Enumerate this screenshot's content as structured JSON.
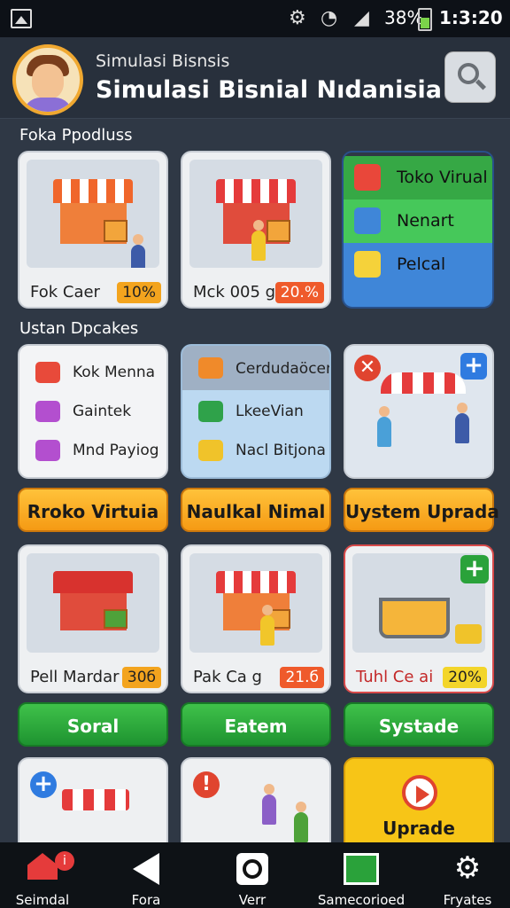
{
  "status": {
    "battery": "38%",
    "time": "1:3:20"
  },
  "header": {
    "subtitle": "Simulasi Bisnsis",
    "title": "Simulasi Bisnial Nıdanisia"
  },
  "section1": {
    "label": "Foka Ppodluss"
  },
  "row1": {
    "card1": {
      "label": "Fok Caer",
      "pct": "10%"
    },
    "card2": {
      "label": "Mck 005 g",
      "pct": "20.%"
    },
    "menu": [
      {
        "label": "Toko Virual",
        "color": "#36a845"
      },
      {
        "label": "Nenart",
        "color": "#46c85a"
      },
      {
        "label": "Pelcal",
        "color": "#3f86d8"
      }
    ]
  },
  "section2": {
    "label": "Ustan Dpcakes"
  },
  "row2": {
    "list1": [
      "Kok Menna",
      "Gaintek",
      "Mnd Payiog"
    ],
    "list2": [
      "Cerdudaöcen",
      "LkeeVian",
      "Nacl Bitjona"
    ]
  },
  "buttons1": [
    "Rroko Virtuia",
    "Naulkal Nimal",
    "Uystem Uprada"
  ],
  "row3": {
    "card1": {
      "label": "Pell Mardar",
      "pct": "30б"
    },
    "card2": {
      "label": "Pak Ca g",
      "pct": "21.б"
    },
    "card3": {
      "label": "Tuhl Ce ai",
      "pct": "20%"
    }
  },
  "buttons2": [
    "Soral",
    "Eatem",
    "Systade"
  ],
  "row4": {
    "upgrade_label": "Uprade"
  },
  "nav": [
    "Seimdal",
    "Fora",
    "Verr",
    "Samecorioed",
    "Fryates"
  ],
  "colors": {
    "accent_orange": "#f59a14",
    "accent_green": "#1e9330",
    "accent_blue": "#3f86d8"
  }
}
